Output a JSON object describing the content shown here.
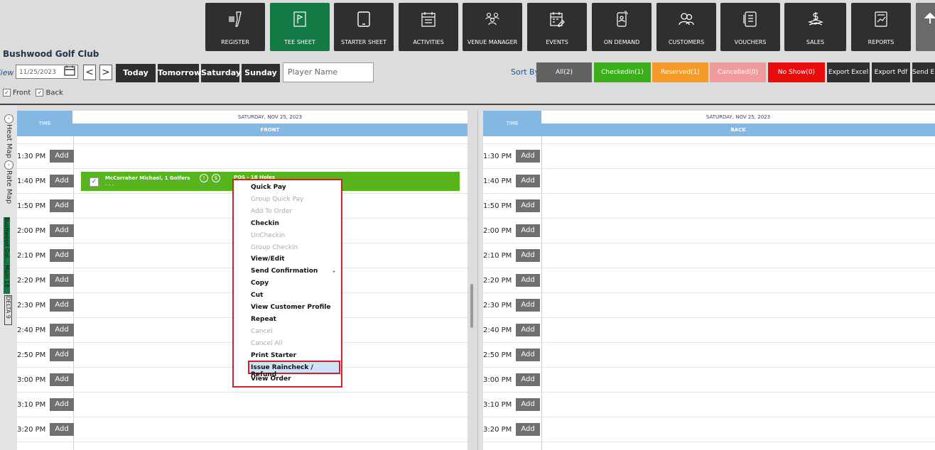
{
  "nav": [
    {
      "label": "REGISTER",
      "icon": "barcode-scanner-icon"
    },
    {
      "label": "TEE SHEET",
      "icon": "flag-board-icon",
      "active": true
    },
    {
      "label": "STARTER SHEET",
      "icon": "tablet-icon"
    },
    {
      "label": "ACTIVITIES",
      "icon": "calendar-icon"
    },
    {
      "label": "VENUE MANAGER",
      "icon": "people-group-icon"
    },
    {
      "label": "EVENTS",
      "icon": "calendar-edit-icon"
    },
    {
      "label": "ON DEMAND",
      "icon": "mobile-user-icon"
    },
    {
      "label": "CUSTOMERS",
      "icon": "customers-icon"
    },
    {
      "label": "VOUCHERS",
      "icon": "voucher-icon"
    },
    {
      "label": "SALES",
      "icon": "dollar-stack-icon"
    },
    {
      "label": "REPORTS",
      "icon": "report-icon"
    },
    {
      "label": "",
      "icon": "upload-arrow-icon"
    }
  ],
  "club_name": "Bushwood Golf Club",
  "toolbar": {
    "view_label": "View",
    "date": "11/25/2023",
    "prev": "<",
    "next": ">",
    "days": [
      "Today",
      "Tomorrow",
      "Saturday",
      "Sunday"
    ],
    "player_placeholder": "Player Name",
    "sort_by": "Sort By",
    "sort_buttons": [
      {
        "label": "All(2)",
        "color": "#626262"
      },
      {
        "label": "CheckedIn(1)",
        "color": "#3cae1c"
      },
      {
        "label": "Reserved(1)",
        "color": "#f59b2c"
      },
      {
        "label": "Cancelled(0)",
        "color": "#f19c9c"
      },
      {
        "label": "No Show(0)",
        "color": "#e80c0c"
      }
    ],
    "export_excel": "Export Excel",
    "export_pdf": "Export Pdf",
    "send": "Send Em"
  },
  "filters": {
    "front": "Front",
    "back": "Back"
  },
  "side": {
    "heat_map": "Heat Map",
    "rate_map": "Rate Map",
    "course": "Bushwood Gol... Main 18",
    "delta": "DELTA 9"
  },
  "front": {
    "time_header": "TIME",
    "date": "SATURDAY, NOV 25, 2023",
    "column": "FRONT"
  },
  "back": {
    "time_header": "TIME",
    "date": "SATURDAY, NOV 25, 2023",
    "column": "BACK"
  },
  "add_label": "Add",
  "times": [
    "1:30 PM",
    "1:40 PM",
    "1:50 PM",
    "2:00 PM",
    "2:10 PM",
    "2:20 PM",
    "2:30 PM",
    "2:40 PM",
    "2:50 PM",
    "3:00 PM",
    "3:10 PM",
    "3:20 PM"
  ],
  "booking": {
    "name": "McCarraher Michael, 1 Golfers",
    "dots": "- - -",
    "info": "!",
    "dollar": "$",
    "pos": "POS - 18 Holes"
  },
  "context_menu": [
    {
      "label": "Quick Pay",
      "enabled": true
    },
    {
      "label": "Group Quick Pay",
      "enabled": false
    },
    {
      "label": "Add To Order",
      "enabled": false
    },
    {
      "label": "Checkin",
      "enabled": true
    },
    {
      "label": "UnCheckin",
      "enabled": false
    },
    {
      "label": "Group Checkin",
      "enabled": false
    },
    {
      "label": "View/Edit",
      "enabled": true
    },
    {
      "label": "Send Confirmation",
      "enabled": true,
      "submenu": true
    },
    {
      "label": "Copy",
      "enabled": true
    },
    {
      "label": "Cut",
      "enabled": true
    },
    {
      "label": "View Customer Profile",
      "enabled": true
    },
    {
      "label": "Repeat",
      "enabled": true
    },
    {
      "label": "Cancel",
      "enabled": false
    },
    {
      "label": "Cancel All",
      "enabled": false
    },
    {
      "label": "Print Starter",
      "enabled": true
    },
    {
      "label": "Issue Raincheck / Refund",
      "enabled": true,
      "highlighted": true
    },
    {
      "label": "View Order",
      "enabled": true
    }
  ]
}
